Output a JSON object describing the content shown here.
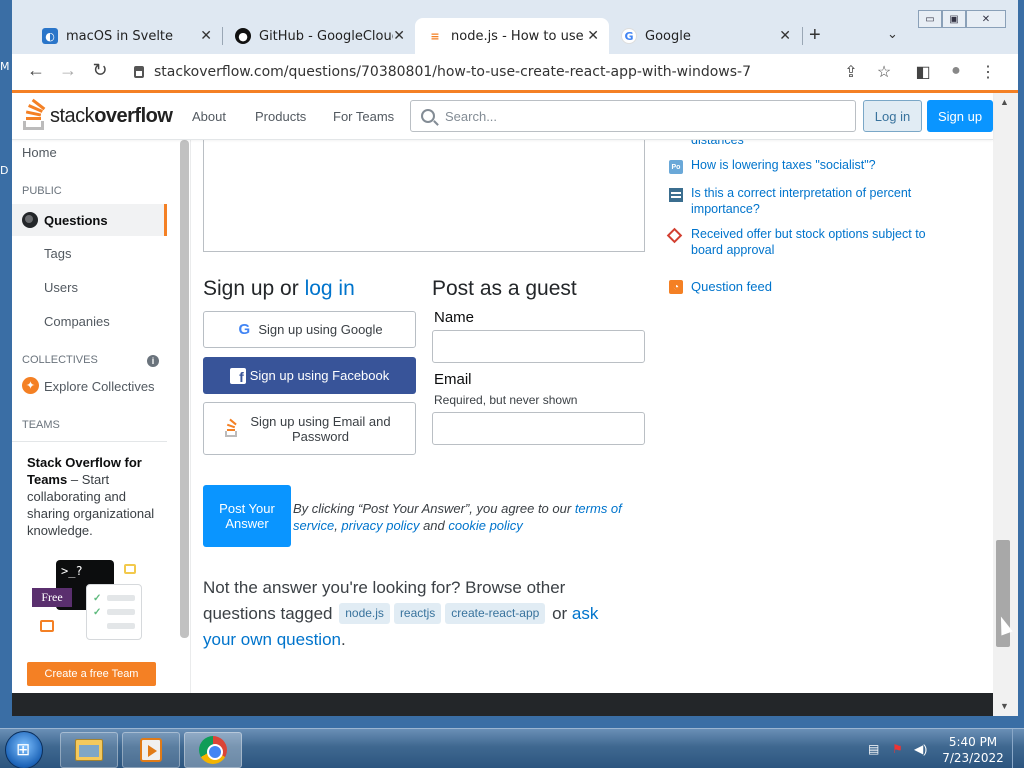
{
  "desktop": {
    "frag_1": "M",
    "frag_2": "D"
  },
  "browser": {
    "tabs": [
      {
        "title": "macOS in Svelte",
        "close": "✕"
      },
      {
        "title": "GitHub - GoogleCloudPl",
        "close": "✕"
      },
      {
        "title": "node.js - How to use cre",
        "close": "✕"
      },
      {
        "title": "Google",
        "close": "✕"
      }
    ],
    "active_tab": 2,
    "new_tab": "+",
    "tab_menu": "⌄",
    "window_controls": {
      "minimize": "▭",
      "maximize": "▣",
      "close": "✕"
    },
    "nav": {
      "back": "←",
      "forward": "→",
      "reload": "↻"
    },
    "url": "stackoverflow.com/questions/70380801/how-to-use-create-react-app-with-windows-7",
    "toolbar_icons": {
      "share": "⇪",
      "bookmark": "☆",
      "sidepanel": "◧",
      "profile": "●",
      "menu": "⋮"
    }
  },
  "header": {
    "logo_plain": "stack",
    "logo_bold": "overflow",
    "nav": [
      "About",
      "Products",
      "For Teams"
    ],
    "search_placeholder": "Search...",
    "login": "Log in",
    "signup": "Sign up"
  },
  "sidebar": {
    "home": "Home",
    "public_head": "PUBLIC",
    "questions": "Questions",
    "tags": "Tags",
    "users": "Users",
    "companies": "Companies",
    "collectives_head": "COLLECTIVES",
    "collectives_info": "i",
    "explore_collectives": "Explore Collectives",
    "teams_head": "TEAMS",
    "teams_title": "Stack Overflow for Teams",
    "teams_dash": " – ",
    "teams_desc": "Start collaborating and sharing organizational knowledge.",
    "illus_prompt": ">_?",
    "illus_free": "Free",
    "create_team": "Create a free Team"
  },
  "answer_form": {
    "signup_heading": "Sign up or",
    "signup_link": "log in",
    "google": "Sign up using Google",
    "google_glyph": "G",
    "facebook": "Sign up using Facebook",
    "facebook_glyph": "f",
    "email": "Sign up using Email and Password",
    "guest_heading": "Post as a guest",
    "name_label": "Name",
    "email_label": "Email",
    "email_hint": "Required, but never shown",
    "post_button": "Post Your Answer",
    "agree_prefix": "By clicking “Post Your Answer”, you agree to our ",
    "terms": "terms of service",
    "sep1": ", ",
    "privacy": "privacy policy",
    "sep2": " and ",
    "cookie": "cookie policy"
  },
  "not_answer": {
    "text": "Not the answer you're looking for? Browse other questions tagged",
    "tags": [
      "node.js",
      "reactjs",
      "create-react-app"
    ],
    "or": "or",
    "ask_link": "ask your own question",
    "end": "."
  },
  "right_col": {
    "partial_link": "distances",
    "hot": [
      {
        "icon": "politics-icon",
        "text": "How is lowering taxes \"socialist\"?"
      },
      {
        "icon": "math-icon",
        "text": "Is this a correct interpretation of percent importance?"
      },
      {
        "icon": "workplace-icon",
        "text": "Received offer but stock options subject to board approval"
      }
    ],
    "feed": "Question feed",
    "po_label": "Po",
    "rss_glyph": "◔"
  },
  "scrollbar": {
    "up": "▲",
    "down": "▼"
  },
  "taskbar": {
    "time": "5:40 PM",
    "date": "7/23/2022",
    "tray_icons": [
      "network-icon",
      "flag-icon",
      "volume-icon"
    ],
    "tray_glyphs": [
      "▤",
      "⚑",
      "◀)"
    ],
    "start_label": "⊞"
  }
}
